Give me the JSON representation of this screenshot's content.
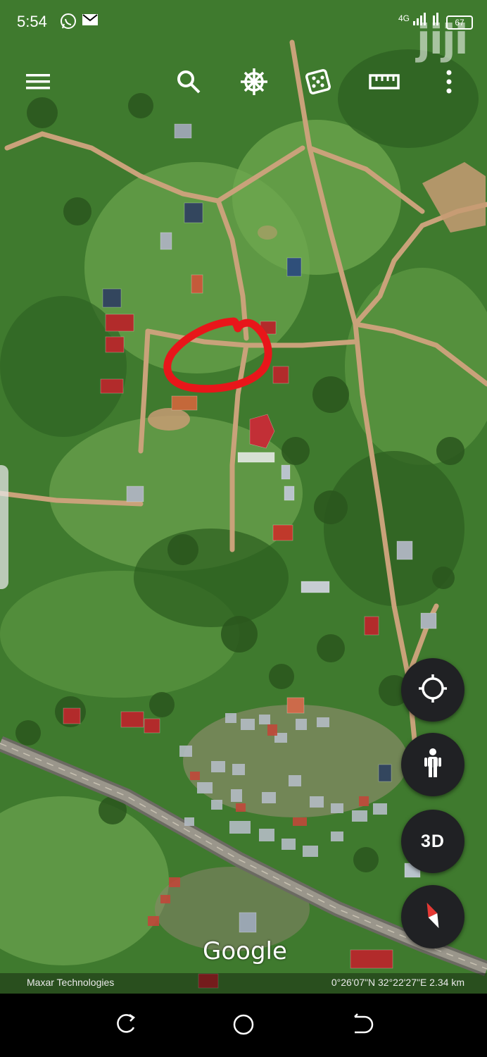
{
  "status_bar": {
    "time": "5:54",
    "network": "4G",
    "battery": "67",
    "icons": [
      "whatsapp-icon",
      "gmail-icon",
      "signal-icon",
      "wifi-icon",
      "battery-icon"
    ]
  },
  "watermark": "jiji",
  "toolbar": {
    "icons": [
      "menu-icon",
      "search-icon",
      "voyager-wheel-icon",
      "feeling-lucky-dice-icon",
      "measure-ruler-icon",
      "more-vert-icon"
    ]
  },
  "map": {
    "type": "satellite",
    "logo": "Google",
    "credit": "Maxar Technologies",
    "coordinates": "0°26'07\"N 32°22'27\"E 2.34 km",
    "highlight_color": "#e8161a"
  },
  "controls": {
    "locate_icon": "my-location-icon",
    "streetview_icon": "pegman-icon",
    "mode_label": "3D",
    "compass_icon": "compass-icon"
  },
  "nav_bar": {
    "icons": [
      "recents-icon",
      "home-icon",
      "back-icon"
    ]
  },
  "colors": {
    "vegetation": "#3f7a2e",
    "dirt_road": "#c9a27a",
    "highway": "#8f8a82",
    "fab_background": "#202124"
  }
}
